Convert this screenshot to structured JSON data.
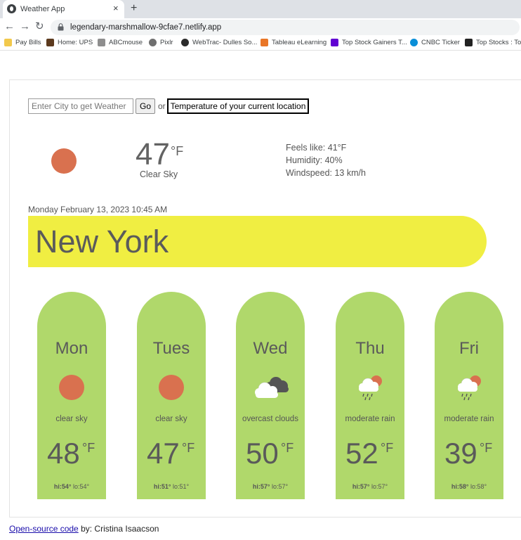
{
  "browser": {
    "tab_title": "Weather App",
    "tab_close": "×",
    "new_tab": "+",
    "url": "legendary-marshmallow-9cfae7.netlify.app",
    "nav": {
      "back": "←",
      "forward": "→",
      "reload": "↻"
    },
    "bookmarks": [
      {
        "label": "Pay Bills",
        "color": "#f2c94c"
      },
      {
        "label": "Home: UPS",
        "color": "#5c3a1e"
      },
      {
        "label": "ABCmouse",
        "color": "#8e8e8e"
      },
      {
        "label": "Pixlr",
        "color": "#6f6f6f"
      },
      {
        "label": "WebTrac- Dulles So...",
        "color": "#2b2b2b"
      },
      {
        "label": "Tableau eLearning",
        "color": "#e97627"
      },
      {
        "label": "Top Stock Gainers T...",
        "color": "#6001d2"
      },
      {
        "label": "CNBC Ticker",
        "color": "#0a8fd8"
      },
      {
        "label": "Top Stocks : Tod",
        "color": "#222222"
      }
    ]
  },
  "search": {
    "placeholder": "Enter City to get Weather",
    "go_label": "Go",
    "or_text": "or",
    "location_button": "Temperature of your current location"
  },
  "current": {
    "temp": "47",
    "unit": "°F",
    "description": "Clear Sky",
    "feels_like": "Feels like: 41°F",
    "humidity": "Humidity: 40%",
    "windspeed": "Windspeed: 13 km/h",
    "icon": "sun-icon"
  },
  "location": {
    "datetime": "Monday February 13, 2023 10:45 AM",
    "city": "New York"
  },
  "forecast": [
    {
      "day": "Mon",
      "description": "clear sky",
      "temp": "48",
      "unit": "°F",
      "hi": "hi:54°",
      "lo": "lo:54°",
      "icon": "sun-icon"
    },
    {
      "day": "Tues",
      "description": "clear sky",
      "temp": "47",
      "unit": "°F",
      "hi": "hi:51°",
      "lo": "lo:51°",
      "icon": "sun-icon"
    },
    {
      "day": "Wed",
      "description": "overcast clouds",
      "temp": "50",
      "unit": "°F",
      "hi": "hi:57°",
      "lo": "lo:57°",
      "icon": "overcast-clouds-icon"
    },
    {
      "day": "Thu",
      "description": "moderate rain",
      "temp": "52",
      "unit": "°F",
      "hi": "hi:57°",
      "lo": "lo:57°",
      "icon": "rain-icon"
    },
    {
      "day": "Fri",
      "description": "moderate rain",
      "temp": "39",
      "unit": "°F",
      "hi": "hi:58°",
      "lo": "lo:58°",
      "icon": "rain-icon"
    }
  ],
  "footer": {
    "link_text": "Open-source code",
    "credit": " by: Cristina Isaacson"
  },
  "colors": {
    "card": "#b0d86b",
    "banner": "#f0ee42",
    "sun": "#d9714f"
  }
}
